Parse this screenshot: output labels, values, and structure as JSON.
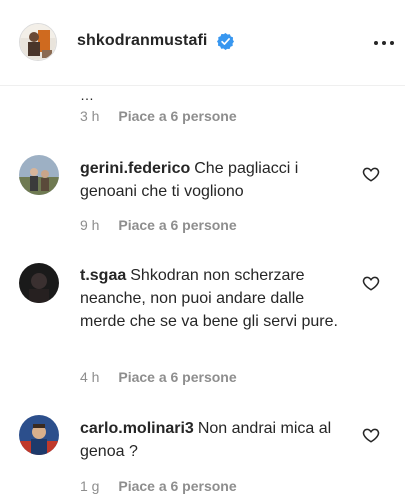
{
  "header": {
    "username": "shkodranmustafi",
    "verified": true
  },
  "partial_text": "…",
  "first_meta": {
    "time": "3 h",
    "likes": "Piace a 6 persone"
  },
  "comments": [
    {
      "user": "gerini.federico",
      "text": "Che pagliacci i genoani che ti vogliono",
      "time": "9 h",
      "likes": "Piace a 6 persone"
    },
    {
      "user": "t.sgaa",
      "text": "Shkodran non scherzare neanche, non puoi andare dalle merde che se va bene gli servi pure.",
      "time": "4 h",
      "likes": "Piace a 6 persone"
    },
    {
      "user": "carlo.molinari3",
      "text": "Non andrai mica al genoa ?",
      "time": "1 g",
      "likes": "Piace a 6 persone"
    }
  ],
  "colors": {
    "text": "#262626",
    "secondary": "#8e8e8e",
    "verified": "#3897f0",
    "divider": "#efefef"
  },
  "icons": [
    "more-options-icon",
    "verified-badge-icon",
    "heart-icon"
  ]
}
